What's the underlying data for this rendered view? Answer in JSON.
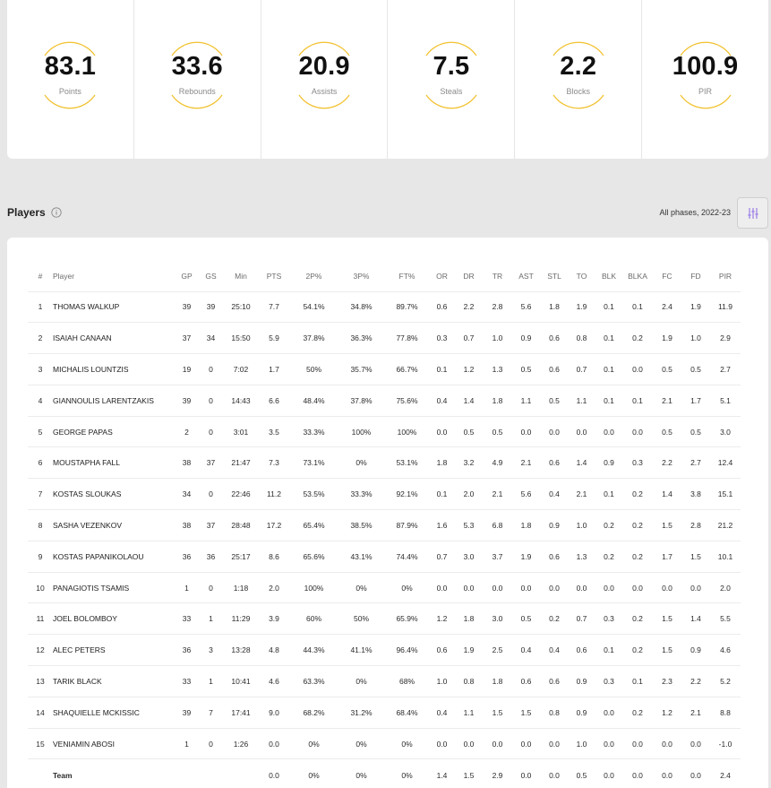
{
  "summary": [
    {
      "value": "83.1",
      "label": "Points"
    },
    {
      "value": "33.6",
      "label": "Rebounds"
    },
    {
      "value": "20.9",
      "label": "Assists"
    },
    {
      "value": "7.5",
      "label": "Steals"
    },
    {
      "value": "2.2",
      "label": "Blocks"
    },
    {
      "value": "100.9",
      "label": "PIR"
    }
  ],
  "players_section": {
    "title": "Players",
    "phase": "All phases, 2022-23"
  },
  "colors": {
    "accent_arc": "#f2c12e",
    "filter_icon": "#9b7be8"
  },
  "table": {
    "columns": [
      "#",
      "Player",
      "GP",
      "GS",
      "Min",
      "PTS",
      "2P%",
      "3P%",
      "FT%",
      "OR",
      "DR",
      "TR",
      "AST",
      "STL",
      "TO",
      "BLK",
      "BLKA",
      "FC",
      "FD",
      "PIR"
    ],
    "rows": [
      [
        "1",
        "Thomas Walkup",
        "39",
        "39",
        "25:10",
        "7.7",
        "54.1%",
        "34.8%",
        "89.7%",
        "0.6",
        "2.2",
        "2.8",
        "5.6",
        "1.8",
        "1.9",
        "0.1",
        "0.1",
        "2.4",
        "1.9",
        "11.9"
      ],
      [
        "2",
        "Isaiah Canaan",
        "37",
        "34",
        "15:50",
        "5.9",
        "37.8%",
        "36.3%",
        "77.8%",
        "0.3",
        "0.7",
        "1.0",
        "0.9",
        "0.6",
        "0.8",
        "0.1",
        "0.2",
        "1.9",
        "1.0",
        "2.9"
      ],
      [
        "3",
        "Michalis Lountzis",
        "19",
        "0",
        "7:02",
        "1.7",
        "50%",
        "35.7%",
        "66.7%",
        "0.1",
        "1.2",
        "1.3",
        "0.5",
        "0.6",
        "0.7",
        "0.1",
        "0.0",
        "0.5",
        "0.5",
        "2.7"
      ],
      [
        "4",
        "Giannoulis Larentzakis",
        "39",
        "0",
        "14:43",
        "6.6",
        "48.4%",
        "37.8%",
        "75.6%",
        "0.4",
        "1.4",
        "1.8",
        "1.1",
        "0.5",
        "1.1",
        "0.1",
        "0.1",
        "2.1",
        "1.7",
        "5.1"
      ],
      [
        "5",
        "George Papas",
        "2",
        "0",
        "3:01",
        "3.5",
        "33.3%",
        "100%",
        "100%",
        "0.0",
        "0.5",
        "0.5",
        "0.0",
        "0.0",
        "0.0",
        "0.0",
        "0.0",
        "0.5",
        "0.5",
        "3.0"
      ],
      [
        "6",
        "Moustapha Fall",
        "38",
        "37",
        "21:47",
        "7.3",
        "73.1%",
        "0%",
        "53.1%",
        "1.8",
        "3.2",
        "4.9",
        "2.1",
        "0.6",
        "1.4",
        "0.9",
        "0.3",
        "2.2",
        "2.7",
        "12.4"
      ],
      [
        "7",
        "Kostas Sloukas",
        "34",
        "0",
        "22:46",
        "11.2",
        "53.5%",
        "33.3%",
        "92.1%",
        "0.1",
        "2.0",
        "2.1",
        "5.6",
        "0.4",
        "2.1",
        "0.1",
        "0.2",
        "1.4",
        "3.8",
        "15.1"
      ],
      [
        "8",
        "Sasha Vezenkov",
        "38",
        "37",
        "28:48",
        "17.2",
        "65.4%",
        "38.5%",
        "87.9%",
        "1.6",
        "5.3",
        "6.8",
        "1.8",
        "0.9",
        "1.0",
        "0.2",
        "0.2",
        "1.5",
        "2.8",
        "21.2"
      ],
      [
        "9",
        "Kostas Papanikolaou",
        "36",
        "36",
        "25:17",
        "8.6",
        "65.6%",
        "43.1%",
        "74.4%",
        "0.7",
        "3.0",
        "3.7",
        "1.9",
        "0.6",
        "1.3",
        "0.2",
        "0.2",
        "1.7",
        "1.5",
        "10.1"
      ],
      [
        "10",
        "Panagiotis Tsamis",
        "1",
        "0",
        "1:18",
        "2.0",
        "100%",
        "0%",
        "0%",
        "0.0",
        "0.0",
        "0.0",
        "0.0",
        "0.0",
        "0.0",
        "0.0",
        "0.0",
        "0.0",
        "0.0",
        "2.0"
      ],
      [
        "11",
        "Joel Bolomboy",
        "33",
        "1",
        "11:29",
        "3.9",
        "60%",
        "50%",
        "65.9%",
        "1.2",
        "1.8",
        "3.0",
        "0.5",
        "0.2",
        "0.7",
        "0.3",
        "0.2",
        "1.5",
        "1.4",
        "5.5"
      ],
      [
        "12",
        "Alec Peters",
        "36",
        "3",
        "13:28",
        "4.8",
        "44.3%",
        "41.1%",
        "96.4%",
        "0.6",
        "1.9",
        "2.5",
        "0.4",
        "0.4",
        "0.6",
        "0.1",
        "0.2",
        "1.5",
        "0.9",
        "4.6"
      ],
      [
        "13",
        "Tarik Black",
        "33",
        "1",
        "10:41",
        "4.6",
        "63.3%",
        "0%",
        "68%",
        "1.0",
        "0.8",
        "1.8",
        "0.6",
        "0.6",
        "0.9",
        "0.3",
        "0.1",
        "2.3",
        "2.2",
        "5.2"
      ],
      [
        "14",
        "Shaquielle McKissic",
        "39",
        "7",
        "17:41",
        "9.0",
        "68.2%",
        "31.2%",
        "68.4%",
        "0.4",
        "1.1",
        "1.5",
        "1.5",
        "0.8",
        "0.9",
        "0.0",
        "0.2",
        "1.2",
        "2.1",
        "8.8"
      ],
      [
        "15",
        "Veniamin Abosi",
        "1",
        "0",
        "1:26",
        "0.0",
        "0%",
        "0%",
        "0%",
        "0.0",
        "0.0",
        "0.0",
        "0.0",
        "0.0",
        "1.0",
        "0.0",
        "0.0",
        "0.0",
        "0.0",
        "-1.0"
      ]
    ],
    "team_row": [
      "",
      "Team",
      "",
      "",
      "",
      "0.0",
      "0%",
      "0%",
      "0%",
      "1.4",
      "1.5",
      "2.9",
      "0.0",
      "0.0",
      "0.5",
      "0.0",
      "0.0",
      "0.0",
      "0.0",
      "2.4"
    ]
  }
}
